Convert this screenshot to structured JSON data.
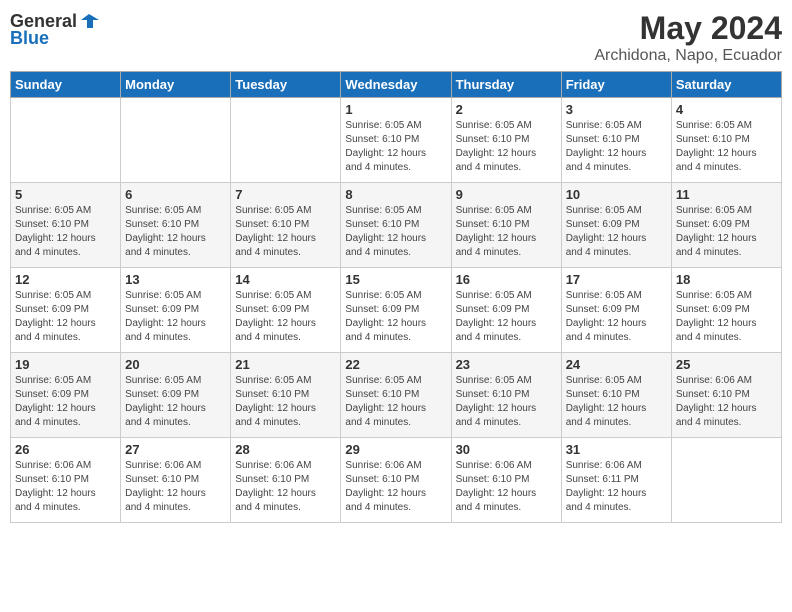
{
  "header": {
    "logo_general": "General",
    "logo_blue": "Blue",
    "month_title": "May 2024",
    "location": "Archidona, Napo, Ecuador"
  },
  "days_of_week": [
    "Sunday",
    "Monday",
    "Tuesday",
    "Wednesday",
    "Thursday",
    "Friday",
    "Saturday"
  ],
  "weeks": [
    [
      {
        "day": "",
        "info": ""
      },
      {
        "day": "",
        "info": ""
      },
      {
        "day": "",
        "info": ""
      },
      {
        "day": "1",
        "info": "Sunrise: 6:05 AM\nSunset: 6:10 PM\nDaylight: 12 hours\nand 4 minutes."
      },
      {
        "day": "2",
        "info": "Sunrise: 6:05 AM\nSunset: 6:10 PM\nDaylight: 12 hours\nand 4 minutes."
      },
      {
        "day": "3",
        "info": "Sunrise: 6:05 AM\nSunset: 6:10 PM\nDaylight: 12 hours\nand 4 minutes."
      },
      {
        "day": "4",
        "info": "Sunrise: 6:05 AM\nSunset: 6:10 PM\nDaylight: 12 hours\nand 4 minutes."
      }
    ],
    [
      {
        "day": "5",
        "info": "Sunrise: 6:05 AM\nSunset: 6:10 PM\nDaylight: 12 hours\nand 4 minutes."
      },
      {
        "day": "6",
        "info": "Sunrise: 6:05 AM\nSunset: 6:10 PM\nDaylight: 12 hours\nand 4 minutes."
      },
      {
        "day": "7",
        "info": "Sunrise: 6:05 AM\nSunset: 6:10 PM\nDaylight: 12 hours\nand 4 minutes."
      },
      {
        "day": "8",
        "info": "Sunrise: 6:05 AM\nSunset: 6:10 PM\nDaylight: 12 hours\nand 4 minutes."
      },
      {
        "day": "9",
        "info": "Sunrise: 6:05 AM\nSunset: 6:10 PM\nDaylight: 12 hours\nand 4 minutes."
      },
      {
        "day": "10",
        "info": "Sunrise: 6:05 AM\nSunset: 6:09 PM\nDaylight: 12 hours\nand 4 minutes."
      },
      {
        "day": "11",
        "info": "Sunrise: 6:05 AM\nSunset: 6:09 PM\nDaylight: 12 hours\nand 4 minutes."
      }
    ],
    [
      {
        "day": "12",
        "info": "Sunrise: 6:05 AM\nSunset: 6:09 PM\nDaylight: 12 hours\nand 4 minutes."
      },
      {
        "day": "13",
        "info": "Sunrise: 6:05 AM\nSunset: 6:09 PM\nDaylight: 12 hours\nand 4 minutes."
      },
      {
        "day": "14",
        "info": "Sunrise: 6:05 AM\nSunset: 6:09 PM\nDaylight: 12 hours\nand 4 minutes."
      },
      {
        "day": "15",
        "info": "Sunrise: 6:05 AM\nSunset: 6:09 PM\nDaylight: 12 hours\nand 4 minutes."
      },
      {
        "day": "16",
        "info": "Sunrise: 6:05 AM\nSunset: 6:09 PM\nDaylight: 12 hours\nand 4 minutes."
      },
      {
        "day": "17",
        "info": "Sunrise: 6:05 AM\nSunset: 6:09 PM\nDaylight: 12 hours\nand 4 minutes."
      },
      {
        "day": "18",
        "info": "Sunrise: 6:05 AM\nSunset: 6:09 PM\nDaylight: 12 hours\nand 4 minutes."
      }
    ],
    [
      {
        "day": "19",
        "info": "Sunrise: 6:05 AM\nSunset: 6:09 PM\nDaylight: 12 hours\nand 4 minutes."
      },
      {
        "day": "20",
        "info": "Sunrise: 6:05 AM\nSunset: 6:09 PM\nDaylight: 12 hours\nand 4 minutes."
      },
      {
        "day": "21",
        "info": "Sunrise: 6:05 AM\nSunset: 6:10 PM\nDaylight: 12 hours\nand 4 minutes."
      },
      {
        "day": "22",
        "info": "Sunrise: 6:05 AM\nSunset: 6:10 PM\nDaylight: 12 hours\nand 4 minutes."
      },
      {
        "day": "23",
        "info": "Sunrise: 6:05 AM\nSunset: 6:10 PM\nDaylight: 12 hours\nand 4 minutes."
      },
      {
        "day": "24",
        "info": "Sunrise: 6:05 AM\nSunset: 6:10 PM\nDaylight: 12 hours\nand 4 minutes."
      },
      {
        "day": "25",
        "info": "Sunrise: 6:06 AM\nSunset: 6:10 PM\nDaylight: 12 hours\nand 4 minutes."
      }
    ],
    [
      {
        "day": "26",
        "info": "Sunrise: 6:06 AM\nSunset: 6:10 PM\nDaylight: 12 hours\nand 4 minutes."
      },
      {
        "day": "27",
        "info": "Sunrise: 6:06 AM\nSunset: 6:10 PM\nDaylight: 12 hours\nand 4 minutes."
      },
      {
        "day": "28",
        "info": "Sunrise: 6:06 AM\nSunset: 6:10 PM\nDaylight: 12 hours\nand 4 minutes."
      },
      {
        "day": "29",
        "info": "Sunrise: 6:06 AM\nSunset: 6:10 PM\nDaylight: 12 hours\nand 4 minutes."
      },
      {
        "day": "30",
        "info": "Sunrise: 6:06 AM\nSunset: 6:10 PM\nDaylight: 12 hours\nand 4 minutes."
      },
      {
        "day": "31",
        "info": "Sunrise: 6:06 AM\nSunset: 6:11 PM\nDaylight: 12 hours\nand 4 minutes."
      },
      {
        "day": "",
        "info": ""
      }
    ]
  ]
}
